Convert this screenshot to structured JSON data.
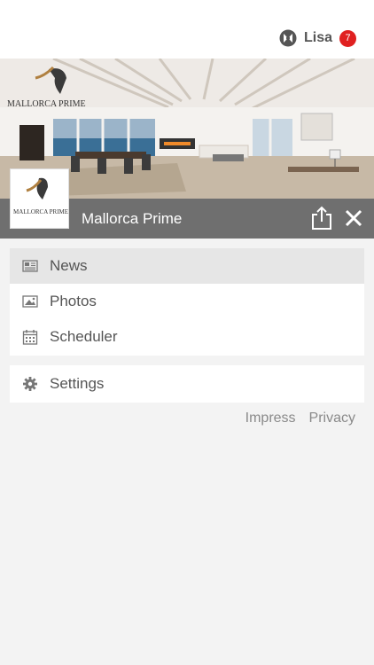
{
  "header": {
    "user_name": "Lisa",
    "notification_count": "7",
    "user_icon": "app-logo-icon",
    "badge_color": "#e02020"
  },
  "hero": {
    "title": "Mallorca Prime",
    "logo_text": "MALLORCA PRIME",
    "share_icon": "share-icon",
    "close_icon": "close-icon",
    "bar_color": "#6f6f6f"
  },
  "menu": {
    "primary": [
      {
        "label": "News",
        "icon": "newspaper-icon",
        "active": true
      },
      {
        "label": "Photos",
        "icon": "image-icon",
        "active": false
      },
      {
        "label": "Scheduler",
        "icon": "calendar-icon",
        "active": false
      }
    ],
    "secondary": [
      {
        "label": "Settings",
        "icon": "gear-icon",
        "active": false
      }
    ]
  },
  "footer": {
    "impress_label": "Impress",
    "privacy_label": "Privacy"
  }
}
